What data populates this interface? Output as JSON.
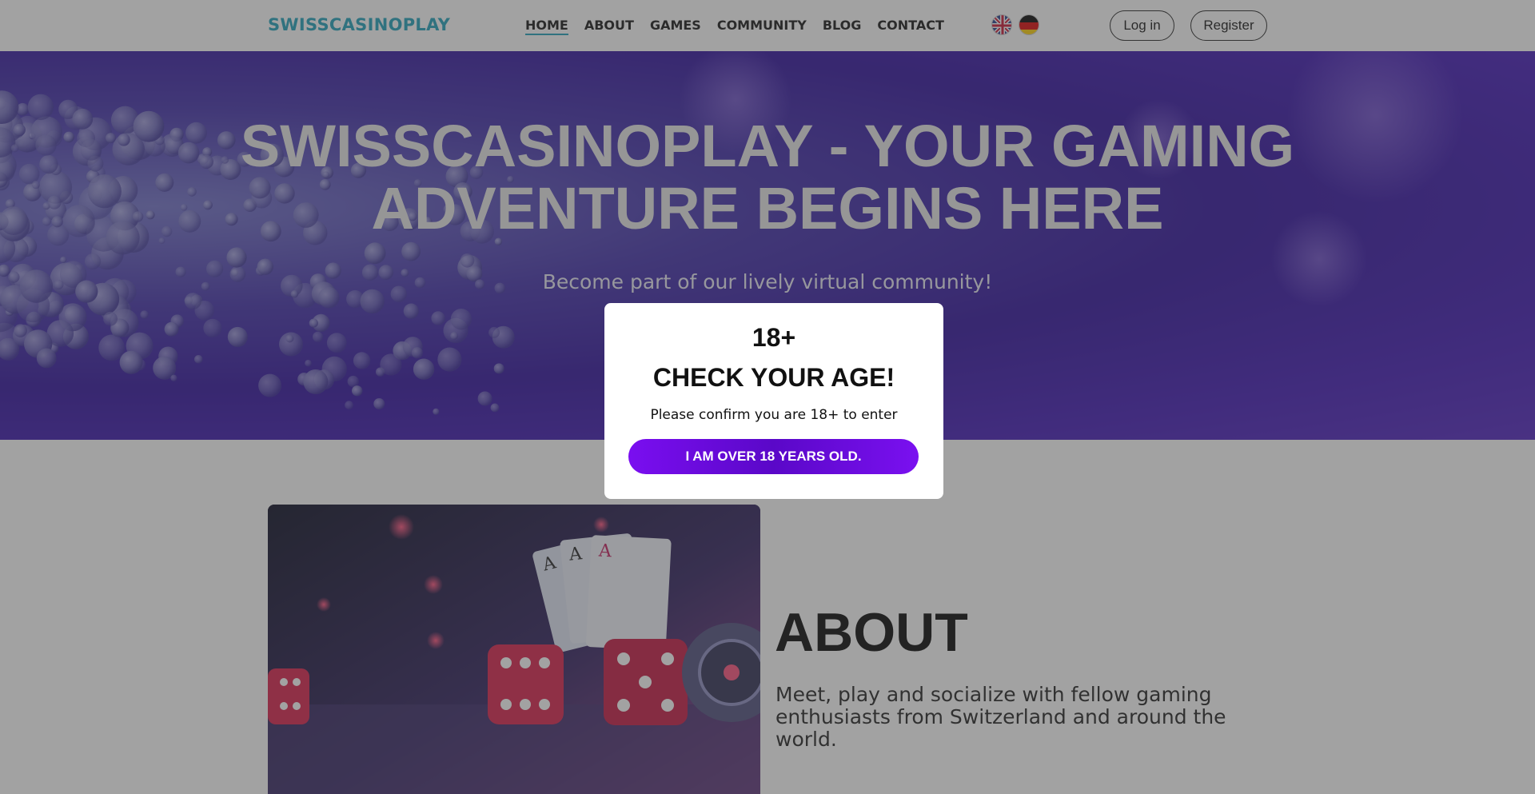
{
  "header": {
    "logo": "SWISSCASINOPLAY",
    "nav": [
      {
        "label": "HOME",
        "active": true
      },
      {
        "label": "ABOUT",
        "active": false
      },
      {
        "label": "GAMES",
        "active": false
      },
      {
        "label": "COMMUNITY",
        "active": false
      },
      {
        "label": "BLOG",
        "active": false
      },
      {
        "label": "CONTACT",
        "active": false
      }
    ],
    "languages": [
      {
        "code": "en",
        "icon": "uk-flag-icon"
      },
      {
        "code": "de",
        "icon": "germany-flag-icon"
      }
    ],
    "login_label": "Log in",
    "register_label": "Register"
  },
  "hero": {
    "title_line1": "SWISSCASINOPLAY - YOUR GAMING",
    "title_line2": "ADVENTURE BEGINS HERE",
    "subtitle": "Become part of our lively virtual community!"
  },
  "about": {
    "title": "ABOUT",
    "text": "Meet, play and socialize with fellow gaming enthusiasts from Switzerland and around the world."
  },
  "age_modal": {
    "age": "18+",
    "title": "CHECK YOUR AGE!",
    "text": "Please confirm you are 18+ to enter",
    "confirm_label": "I AM OVER 18 YEARS OLD."
  },
  "colors": {
    "brand": "#1a9fb8",
    "hero_purple": "#2a0a9a",
    "button_purple": "#7a0ef0"
  }
}
